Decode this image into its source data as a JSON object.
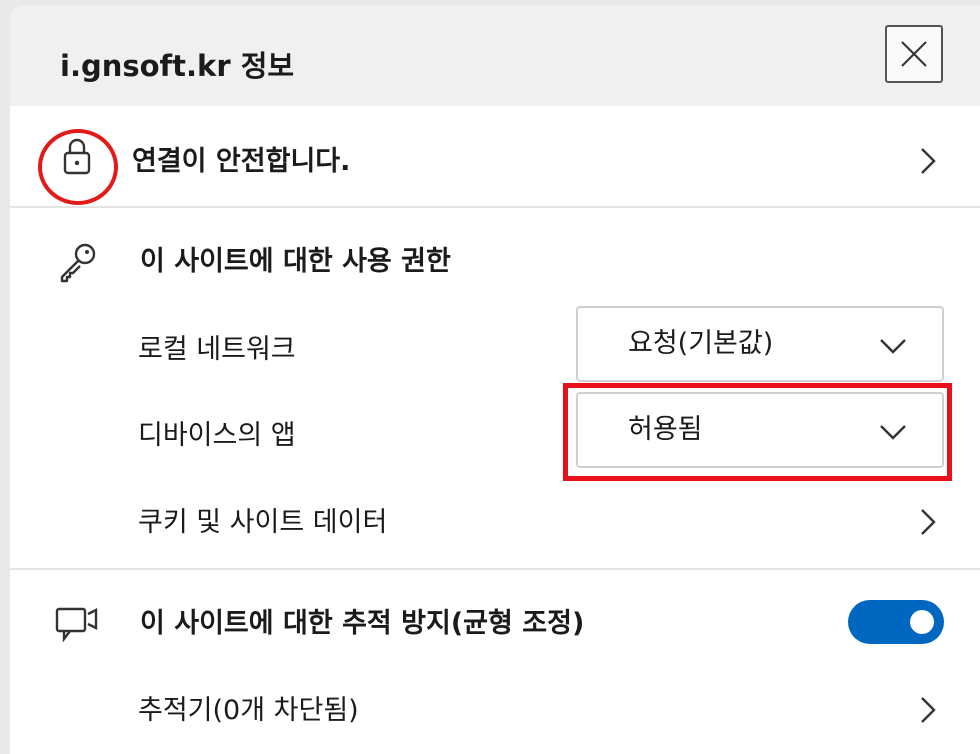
{
  "header": {
    "title": "i.gnsoft.kr 정보"
  },
  "connection": {
    "label": "연결이 안전합니다."
  },
  "permissions": {
    "heading": "이 사이트에 대한 사용 권한",
    "local_network": {
      "label": "로컬 네트워크",
      "value": "요청(기본값)"
    },
    "device_apps": {
      "label": "디바이스의 앱",
      "value": "허용됨"
    },
    "cookies": {
      "label": "쿠키 및 사이트 데이터"
    }
  },
  "tracking": {
    "heading": "이 사이트에 대한 추적 방지(균형 조정)",
    "toggle_on": true,
    "trackers_label": "추적기(0개 차단됨)"
  },
  "colors": {
    "accent": "#0067c0",
    "highlight": "#e8101a",
    "header_bg": "#f0f0f0"
  },
  "icons": [
    "close-icon",
    "lock-icon",
    "key-icon",
    "tracking-icon",
    "chevron-right-icon",
    "chevron-down-icon"
  ]
}
